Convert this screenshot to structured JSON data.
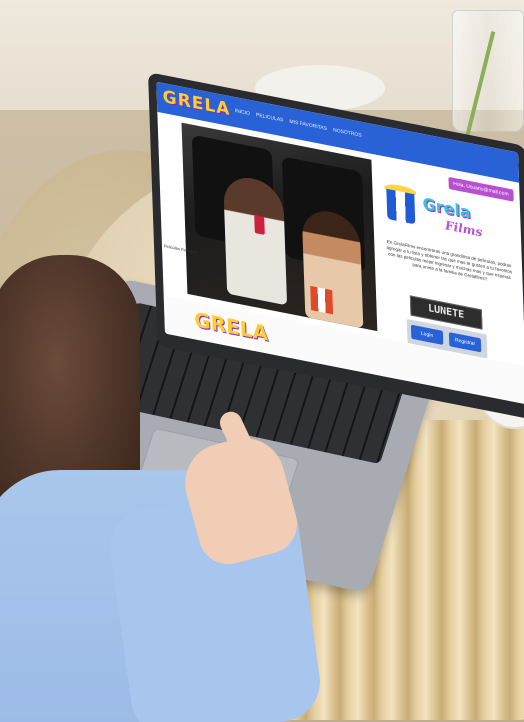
{
  "site": {
    "logo_text": "GRELA",
    "nav_links": [
      "Inicio",
      "Peliculas",
      "Mis Favoritas",
      "Nosotros"
    ],
    "account_button": "Hola, Usuario@mail.com",
    "hero_caption": "",
    "left_caption": "Peliculas Favoritas",
    "brand_name": "Grela",
    "brand_sub": "Films",
    "description": "En GrelaFilms encontraras una grandiosa de peliculas, podras agregar a tu lista y obtener las que mas te gusten a tu favoritos con las peliculas mejor ingresar y muchas mas y que esperas para unirte a la familia de Grelafilms!!",
    "sign_text": "LUNETE",
    "login_label": "Login",
    "register_label": "Registrar",
    "bottom_logo": "GRELA"
  },
  "colors": {
    "navbar": "#2962d6",
    "accent": "#b84fd0",
    "logo": "#ffcc33",
    "brand": "#37c3f0"
  }
}
